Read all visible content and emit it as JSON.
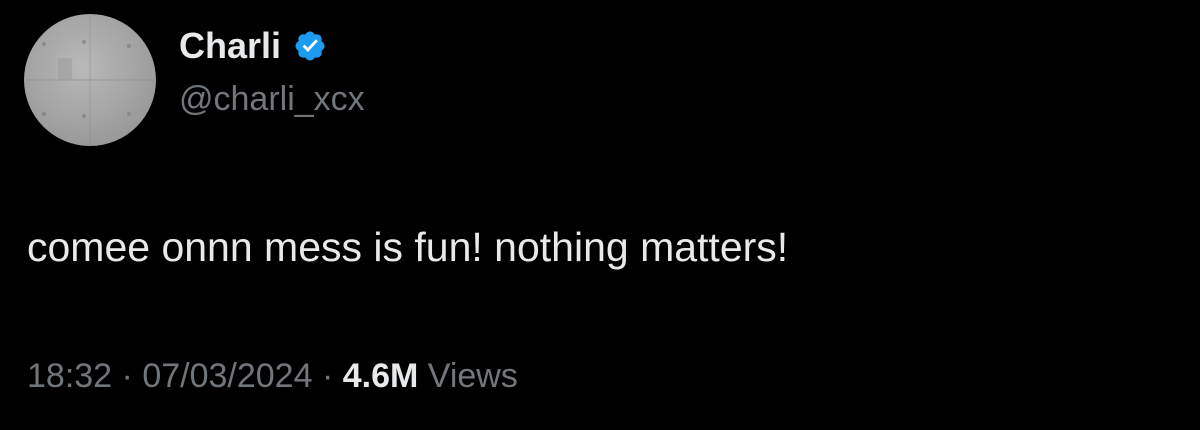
{
  "tweet": {
    "author": {
      "display_name": "Charli",
      "handle": "@charli_xcx",
      "verified_icon": "verified-badge-icon",
      "verified_color": "#1d9bf0"
    },
    "text": "comee onnn mess is fun! nothing matters!",
    "meta": {
      "time": "18:32",
      "separator": "·",
      "date": "07/03/2024",
      "views_count": "4.6M",
      "views_label": "Views"
    }
  },
  "colors": {
    "background": "#000000",
    "primary_text": "#e7e9ea",
    "secondary_text": "#71767b"
  }
}
